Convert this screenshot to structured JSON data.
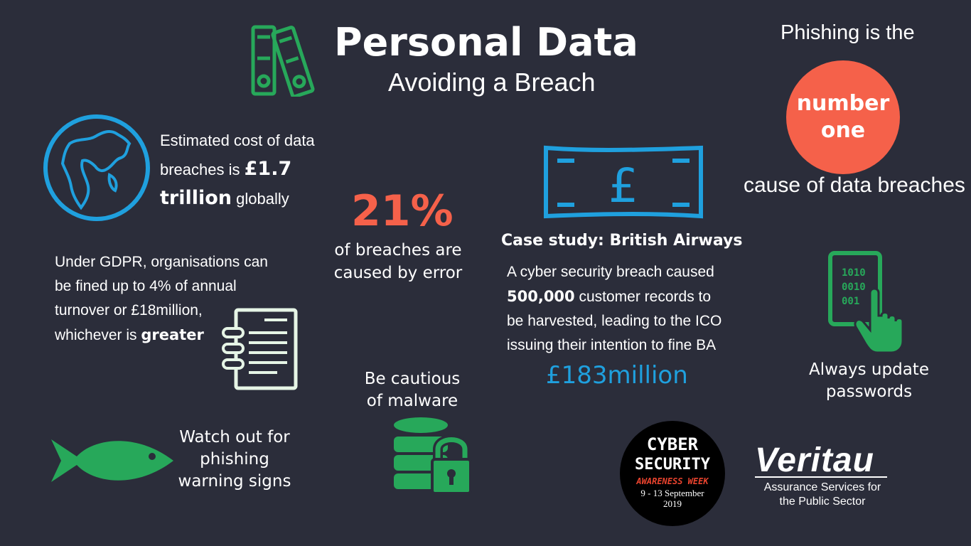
{
  "header": {
    "title": "Personal Data",
    "subtitle": "Avoiding a Breach"
  },
  "phishing": {
    "top": "Phishing is the",
    "circle_line1": "number",
    "circle_line2": "one",
    "bottom": "cause of data breaches"
  },
  "cost": {
    "line1": "Estimated cost of data",
    "line2_pre": "breaches is ",
    "line2_bold": "£1.7",
    "line3_bold": "trillion",
    "line3_post": " globally"
  },
  "error_stat": {
    "percent": "21%",
    "line1": "of breaches are",
    "line2": "caused by error"
  },
  "gdpr": {
    "line1": "Under GDPR, organisations can",
    "line2": "be fined up to 4% of annual",
    "line3": "turnover or £18million,",
    "line4_pre": "whichever is ",
    "line4_bold": "greater"
  },
  "case_study": {
    "title": "Case study: British Airways",
    "line1": "A cyber security breach caused",
    "line2_bold": "500,000",
    "line2_post": " customer records to",
    "line3": "be harvested, leading to the ICO",
    "line4": "issuing their intention to fine BA",
    "fine": "£183million"
  },
  "passwords": {
    "line1": "Always update",
    "line2": "passwords",
    "tablet_code": [
      "1010",
      "0010",
      "001"
    ]
  },
  "malware": {
    "line1": "Be cautious",
    "line2": "of malware"
  },
  "phishing_signs": {
    "line1": "Watch out for",
    "line2": "phishing",
    "line3": "warning signs"
  },
  "badge": {
    "line1": "CYBER",
    "line2": "SECURITY",
    "line3": "AWARENESS WEEK",
    "line4": "9 - 13 September",
    "line5": "2019"
  },
  "veritau": {
    "logo": "Veritau",
    "line1": "Assurance Services for",
    "line2": "the Public Sector"
  },
  "icons": {
    "binders": "binders-icon",
    "globe": "globe-icon",
    "banknote": "pound-banknote-icon",
    "document": "document-icon",
    "tablet": "tablet-touch-icon",
    "database": "database-lock-icon",
    "fish": "fish-icon"
  },
  "colors": {
    "background": "#2b2d3a",
    "accent_red": "#f5614a",
    "accent_blue": "#1fa0de",
    "accent_green": "#27a85a",
    "document_white": "#e6f5e6"
  }
}
